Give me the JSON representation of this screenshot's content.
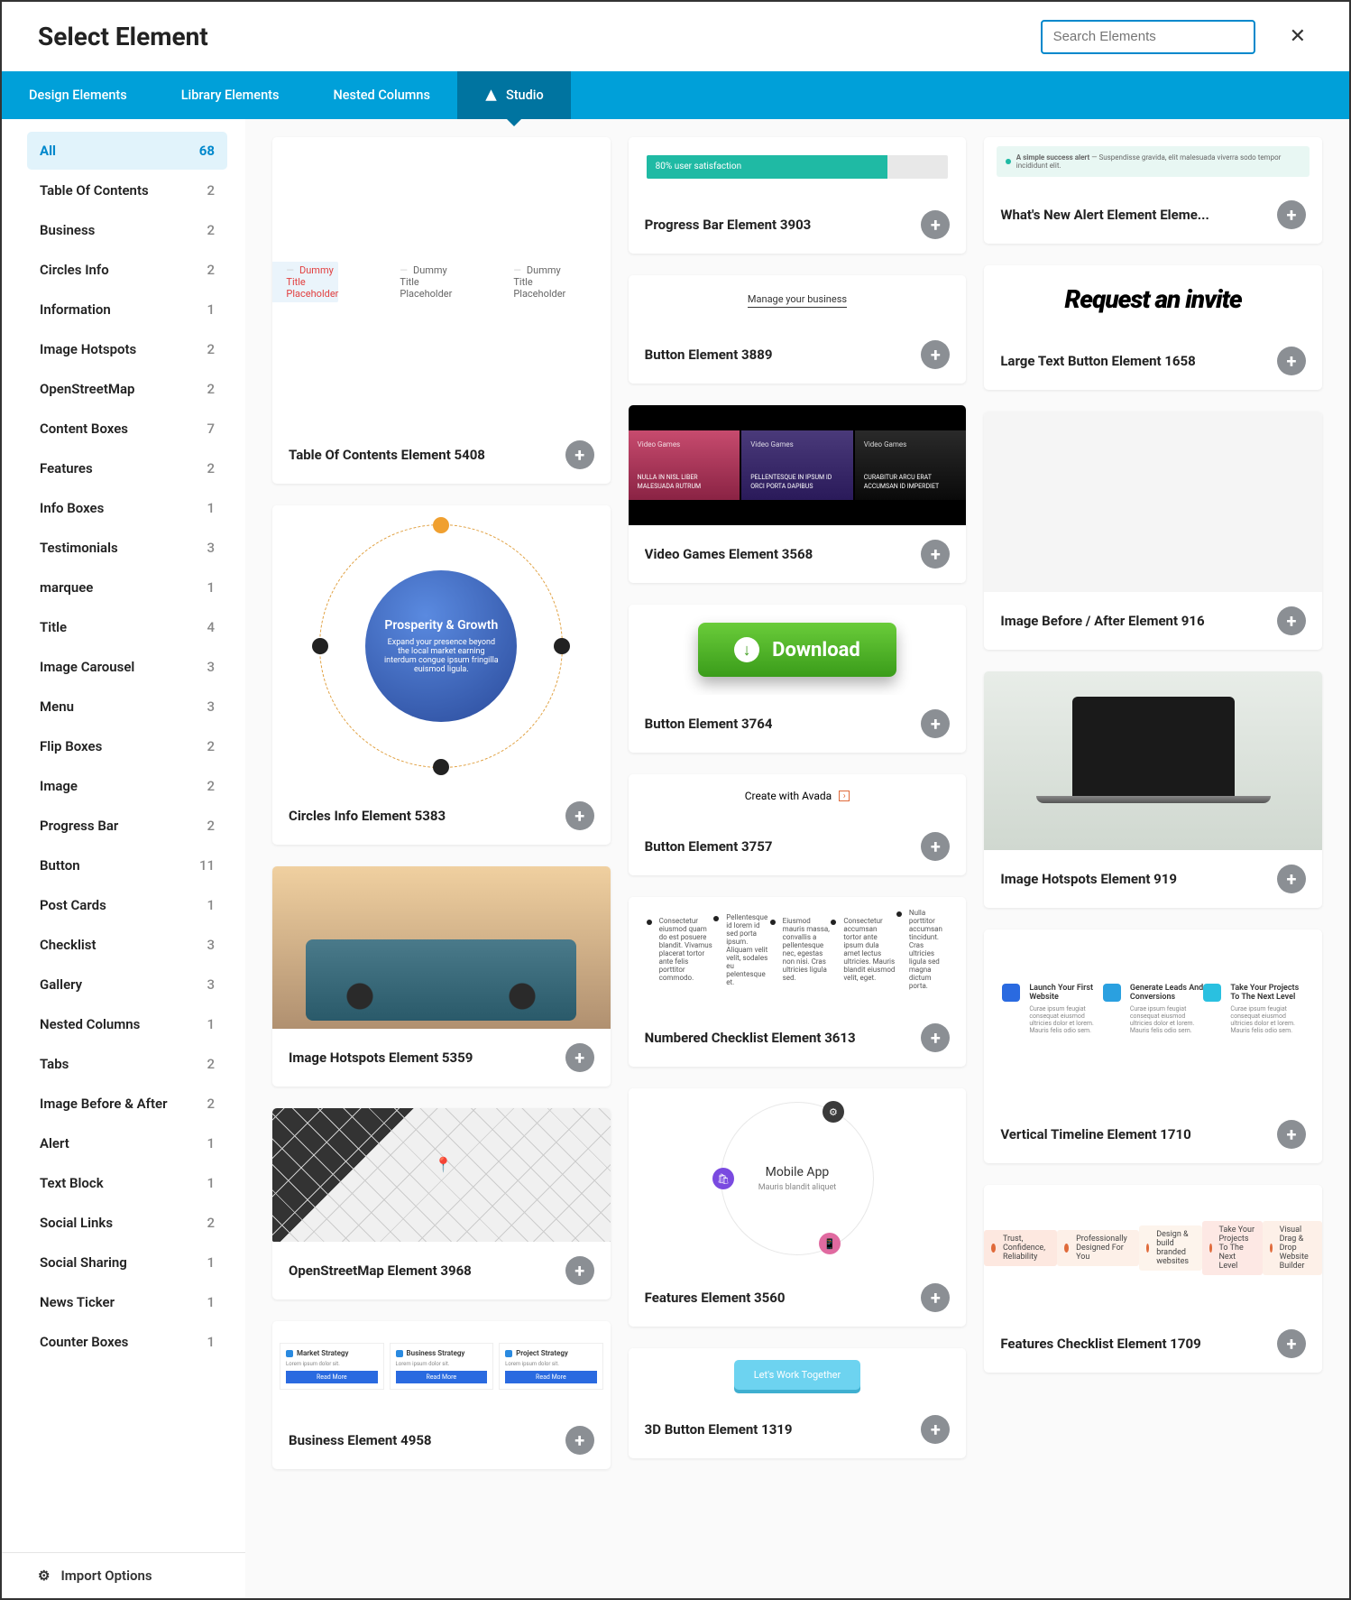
{
  "header": {
    "title": "Select Element",
    "search_placeholder": "Search Elements"
  },
  "tabs": [
    {
      "label": "Design Elements",
      "active": false
    },
    {
      "label": "Library Elements",
      "active": false
    },
    {
      "label": "Nested Columns",
      "active": false
    },
    {
      "label": "Studio",
      "active": true
    }
  ],
  "categories": [
    {
      "label": "All",
      "count": 68,
      "active": true
    },
    {
      "label": "Table Of Contents",
      "count": 2
    },
    {
      "label": "Business",
      "count": 2
    },
    {
      "label": "Circles Info",
      "count": 2
    },
    {
      "label": "Information",
      "count": 1
    },
    {
      "label": "Image Hotspots",
      "count": 2
    },
    {
      "label": "OpenStreetMap",
      "count": 2
    },
    {
      "label": "Content Boxes",
      "count": 7
    },
    {
      "label": "Features",
      "count": 2
    },
    {
      "label": "Info Boxes",
      "count": 1
    },
    {
      "label": "Testimonials",
      "count": 3
    },
    {
      "label": "marquee",
      "count": 1
    },
    {
      "label": "Title",
      "count": 4
    },
    {
      "label": "Image Carousel",
      "count": 3
    },
    {
      "label": "Menu",
      "count": 3
    },
    {
      "label": "Flip Boxes",
      "count": 2
    },
    {
      "label": "Image",
      "count": 2
    },
    {
      "label": "Progress Bar",
      "count": 2
    },
    {
      "label": "Button",
      "count": 11
    },
    {
      "label": "Post Cards",
      "count": 1
    },
    {
      "label": "Checklist",
      "count": 3
    },
    {
      "label": "Gallery",
      "count": 3
    },
    {
      "label": "Nested Columns",
      "count": 1
    },
    {
      "label": "Tabs",
      "count": 2
    },
    {
      "label": "Image Before & After",
      "count": 2
    },
    {
      "label": "Alert",
      "count": 1
    },
    {
      "label": "Text Block",
      "count": 1
    },
    {
      "label": "Social Links",
      "count": 2
    },
    {
      "label": "Social Sharing",
      "count": 1
    },
    {
      "label": "News Ticker",
      "count": 1
    },
    {
      "label": "Counter Boxes",
      "count": 1
    }
  ],
  "footer": {
    "import": "Import Options"
  },
  "col1": [
    {
      "title": "Table Of Contents Element 5408",
      "preview": "toc"
    },
    {
      "title": "Circles Info Element 5383",
      "preview": "circles"
    },
    {
      "title": "Image Hotspots Element 5359",
      "preview": "bike"
    },
    {
      "title": "OpenStreetMap Element 3968",
      "preview": "map"
    },
    {
      "title": "Business Element 4958",
      "preview": "biz"
    }
  ],
  "col2": [
    {
      "title": "Progress Bar Element 3903",
      "preview": "progress"
    },
    {
      "title": "Button Element 3889",
      "preview": "mb"
    },
    {
      "title": "Video Games Element 3568",
      "preview": "vg"
    },
    {
      "title": "Button Element 3764",
      "preview": "download"
    },
    {
      "title": "Button Element 3757",
      "preview": "ca"
    },
    {
      "title": "Numbered Checklist Element 3613",
      "preview": "nc"
    },
    {
      "title": "Features Element 3560",
      "preview": "feat"
    }
  ],
  "col3": [
    {
      "title": "3D Button Element 1319",
      "preview": "3dbtn"
    },
    {
      "title": "What's New Alert Element Eleme...",
      "preview": "alert"
    },
    {
      "title": "Large Text Button Element 1658",
      "preview": "request"
    },
    {
      "title": "Image Before / After Element 916",
      "preview": "houses"
    },
    {
      "title": "Image Hotspots Element 919",
      "preview": "laptop"
    },
    {
      "title": "Vertical Timeline Element 1710",
      "preview": "vt"
    },
    {
      "title": "Features Checklist Element 1709",
      "preview": "fc"
    }
  ],
  "previews": {
    "toc_line": "Dummy Title Placeholder",
    "progress_label": "80% user satisfaction",
    "3dbtn_label": "Let's Work Together",
    "mb_label": "Manage your business",
    "request_label": "Request an invite",
    "download_label": "Download",
    "ca_label": "Create with Avada",
    "circles_title": "Prosperity & Growth",
    "circles_sub": "Expand your presence beyond the local market earning interdum congue ipsum fringilla euismod ligula.",
    "alert_title": "A simple success alert",
    "alert_body": "— Suspendisse gravida, elit malesuada viverra sodo tempor incididunt elit.",
    "vg_tag": "Video Games",
    "vg_c1": "NULLA IN NISL LIBER MALESUADA RUTRUM",
    "vg_c2": "PELLENTESQUE IN IPSUM ID ORCI PORTA DAPIBUS",
    "vg_c3": "CURABITUR ARCU ERAT ACCUMSAN ID IMPERDIET",
    "nc_1": "Consectetur eiusmod quam do est posuere blandit. Vivamus placerat tortor ante felis porttitor commodo.",
    "nc_2": "Pellentesque id lorem id sed porta ipsum. Aliquam velit velit, sodales eu pelentesque et.",
    "nc_3": "Eiusmod mauris massa, convallis a pellentesque nec, egestas non nisi. Cras ultricies ligula sed.",
    "nc_4": "Consectetur accumsan tortor ante ipsum dula amet lectus ultricies. Mauris blandit eiusmod velit, eget.",
    "nc_5": "Nulla porttitor accumsan tincidunt. Cras ultricies ligula sed magna dictum porta.",
    "vt_1": "Launch Your First Website",
    "vt_2": "Generate Leads And Conversions",
    "vt_3": "Take Your Projects To The Next Level",
    "vt_sub": "Curae ipsum feugiat consequat eiusmod ultricies dolor et lorem. Mauris felis odio sem.",
    "biz_h1": "Market Strategy",
    "biz_h2": "Business Strategy",
    "biz_h3": "Project Strategy",
    "biz_btn": "Read More",
    "feat_title": "Mobile App",
    "feat_sub": "Mauris blandit aliquet",
    "fc_1": "Trust, Confidence, Reliability",
    "fc_2": "Professionally Designed For You",
    "fc_3": "Design & build branded websites",
    "fc_4": "Take Your Projects To The Next Level",
    "fc_5": "Visual Drag & Drop Website Builder"
  }
}
